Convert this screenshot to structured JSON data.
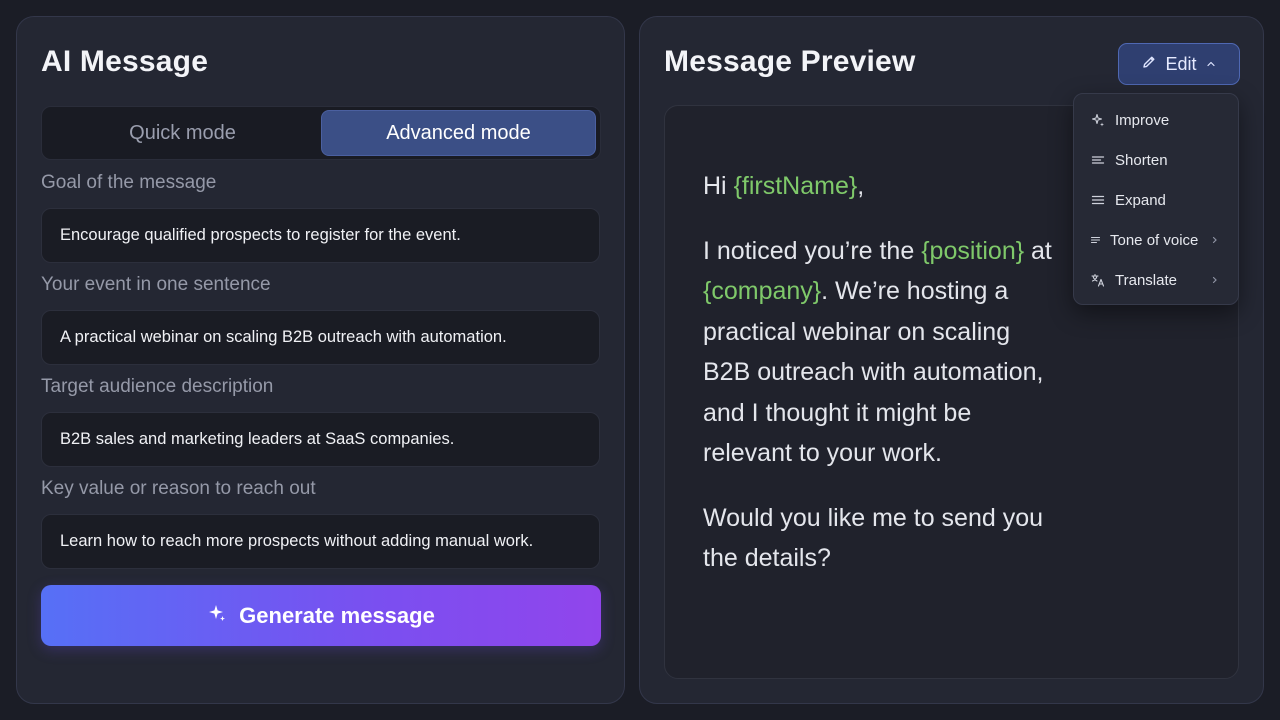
{
  "left_panel": {
    "title": "AI Message",
    "modes": {
      "quick": "Quick mode",
      "advanced": "Advanced mode",
      "selected": "Advanced mode"
    },
    "fields": [
      {
        "label": "Goal of the message",
        "value": "Encourage qualified prospects to register for the event."
      },
      {
        "label": "Your event in one sentence",
        "value": "A practical webinar on scaling B2B outreach with automation."
      },
      {
        "label": "Target audience description",
        "value": "B2B sales and marketing leaders at SaaS companies."
      },
      {
        "label": "Key value or reason to reach out",
        "value": "Learn how to reach more prospects without adding manual work."
      }
    ],
    "generate_label": "Generate message"
  },
  "right_panel": {
    "title": "Message Preview",
    "edit_label": "Edit",
    "preview": {
      "greeting": "Hi ",
      "first_name_var": "{firstName}",
      "greeting_end": ",",
      "p2_start": "I noticed you’re the ",
      "position_var": "{position}",
      "p2_mid": " at ",
      "company_var": "{company}",
      "p2_end": ". We’re hosting a practical webinar on scaling B2B outreach with automation, and I thought it might be relevant to your work.",
      "p3": "Would you like me to send you the details?"
    },
    "edit_menu": [
      {
        "label": "Improve",
        "icon": "sparkle-icon"
      },
      {
        "label": "Shorten",
        "icon": "shorten-lines-icon"
      },
      {
        "label": "Expand",
        "icon": "expand-lines-icon"
      },
      {
        "label": "Tone of voice",
        "icon": "tone-lines-icon",
        "submenu": true
      },
      {
        "label": "Translate",
        "icon": "translate-icon",
        "submenu": true
      }
    ]
  },
  "colors": {
    "background": "#1b1d26",
    "panel": "#242733",
    "accent_blue": "#3b4f86",
    "variable_green": "#7fc96a",
    "gradient_start": "#5670f6",
    "gradient_end": "#9145ec"
  }
}
